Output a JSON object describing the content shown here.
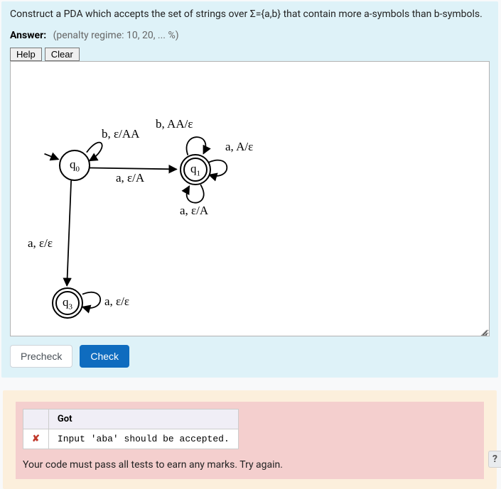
{
  "question": {
    "prompt": "Construct a PDA which accepts the set of strings over Σ={a,b} that contain more a-symbols than b-symbols.",
    "answer_label": "Answer:",
    "penalty": "(penalty regime: 10, 20, ... %)"
  },
  "toolbar": {
    "help": "Help",
    "clear": "Clear"
  },
  "pda": {
    "states": {
      "q0": "q",
      "q0sub": "0",
      "q1": "q",
      "q1sub": "1",
      "q3": "q",
      "q3sub": "3"
    },
    "labels": {
      "q0_loop": "b, ε/AA",
      "q1_top": "b, AA/ε",
      "q1_right": "a, A/ε",
      "q1_bottom": "a, ε/A",
      "q0_q1": "a, ε/A",
      "q0_q3": "a, ε/ε",
      "q3_loop": "a, ε/ε"
    }
  },
  "actions": {
    "precheck": "Precheck",
    "check": "Check"
  },
  "feedback": {
    "header": "Got",
    "x": "✘",
    "detail": "Input 'aba' should be accepted.",
    "summary": "Your code must pass all tests to earn any marks. Try again."
  },
  "helpq": "?"
}
